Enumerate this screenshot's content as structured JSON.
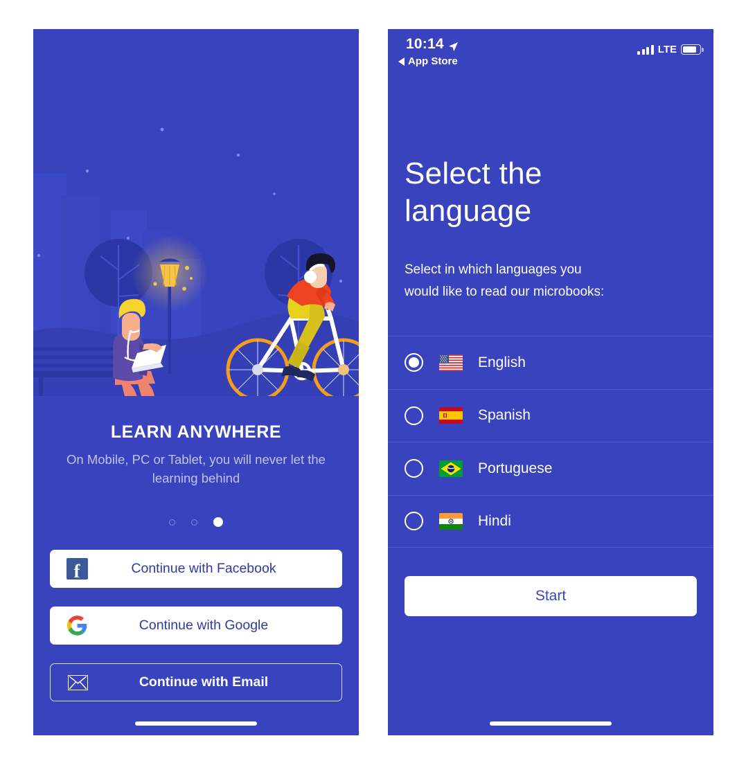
{
  "colors": {
    "brand_blue": "#3943BD",
    "divider": "#4E59D6",
    "subtext": "#BFC4EA",
    "facebook_blue": "#3B5998",
    "button_text_blue": "#2E3A9E",
    "lamp_glow": "#F6C44A",
    "bike_rim": "#F59C1C"
  },
  "status_bar": {
    "time": "10:14",
    "location_icon": "location-arrow-icon",
    "back_label": "App Store",
    "back_icon": "triangle-left-icon",
    "signal_icon": "signal-bars-icon",
    "network": "LTE",
    "battery_icon": "battery-icon"
  },
  "screen_onboarding": {
    "illustration_alt": "night park with person on bench using laptop and cyclist",
    "headline": "LEARN ANYWHERE",
    "subcopy": "On Mobile, PC or Tablet, you will never let the learning behind",
    "pager": {
      "total": 3,
      "active_index": 2
    },
    "buttons": [
      {
        "id": "facebook",
        "label": "Continue with Facebook",
        "icon": "facebook-icon",
        "style": "white"
      },
      {
        "id": "google",
        "label": "Continue with Google",
        "icon": "google-icon",
        "style": "white"
      },
      {
        "id": "email",
        "label": "Continue with Email",
        "icon": "envelope-icon",
        "style": "outline"
      }
    ]
  },
  "screen_language": {
    "title_line1": "Select the",
    "title_line2": "language",
    "subtitle_line1": "Select in which languages you",
    "subtitle_line2": "would like to read our microbooks:",
    "languages": [
      {
        "name": "English",
        "flag": "flag-us",
        "selected": true
      },
      {
        "name": "Spanish",
        "flag": "flag-es",
        "selected": false
      },
      {
        "name": "Portuguese",
        "flag": "flag-br",
        "selected": false
      },
      {
        "name": "Hindi",
        "flag": "flag-in",
        "selected": false
      }
    ],
    "start_label": "Start"
  }
}
